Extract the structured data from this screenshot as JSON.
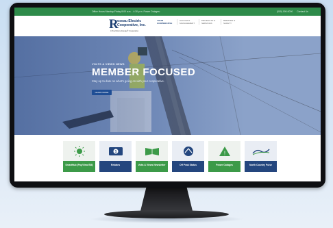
{
  "topbar": {
    "hours": "Office Hours Monday-Friday 8:00 a.m. - 4:30 p.m.  Power Outages:",
    "phone": "(000) 000-0000",
    "contact": "Contact Us"
  },
  "logo": {
    "initial": "R",
    "line1": "oseau Electric",
    "line2": "Cooperative, Inc.",
    "tagline": "A Touchstone Energy® Cooperative"
  },
  "nav": [
    {
      "label": "YOUR COOPERATIVE"
    },
    {
      "label": "ACCOUNT MANAGEMENT"
    },
    {
      "label": "PRODUCTS & SERVICES"
    },
    {
      "label": "REBATES & SAFETY"
    }
  ],
  "hero": {
    "kicker": "VOLTS & VIEWS NEWS",
    "title": "MEMBER FOCUSED",
    "subtitle": "Stay up to date on what's going on with your cooperative.",
    "button": "LEARN MORE"
  },
  "cards": [
    {
      "label": "SmartHub (Pay/View Bill)",
      "color": "#3c9a48",
      "icon": "smarthub-icon"
    },
    {
      "label": "Rebates",
      "color": "#24467e",
      "icon": "dollar-bill-icon"
    },
    {
      "label": "Volts & Views Newsletter",
      "color": "#3c9a48",
      "icon": "open-book-icon"
    },
    {
      "label": "Off Peak Status",
      "color": "#24467e",
      "icon": "off-peak-icon"
    },
    {
      "label": "Power Outages",
      "color": "#3c9a48",
      "icon": "warning-triangle-icon"
    },
    {
      "label": "North Country Pulse",
      "color": "#24467e",
      "icon": "north-country-icon"
    }
  ],
  "colors": {
    "brand_green": "#2e8b4a",
    "brand_navy": "#1c3f73",
    "monitor_bezel": "#0e0f12"
  }
}
